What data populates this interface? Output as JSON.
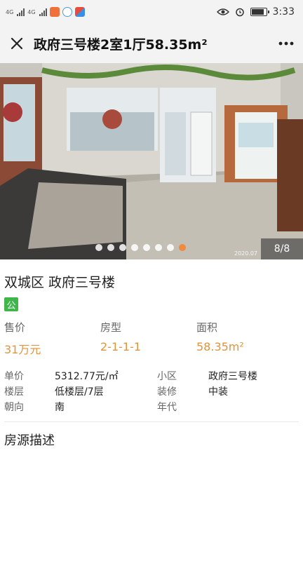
{
  "status_bar": {
    "network_1": "4G",
    "network_2": "4G",
    "time": "3:33"
  },
  "nav": {
    "title": "政府三号楼2室1厅58.35m²"
  },
  "gallery": {
    "counter": "8/8",
    "dot_count": 8,
    "active_index": 7,
    "photo_stamp": "2020.07"
  },
  "listing": {
    "location": "双城区 政府三号楼",
    "tag": "公",
    "stats": [
      {
        "label": "售价",
        "value": "31万元"
      },
      {
        "label": "房型",
        "value": "2-1-1-1"
      },
      {
        "label": "面积",
        "value": "58.35m²"
      }
    ],
    "details": [
      {
        "label": "单价",
        "value": "5312.77元/㎡"
      },
      {
        "label": "小区",
        "value": "政府三号楼"
      },
      {
        "label": "楼层",
        "value": "低楼层/7层"
      },
      {
        "label": "装修",
        "value": "中装"
      },
      {
        "label": "朝向",
        "value": "南"
      },
      {
        "label": "年代",
        "value": ""
      }
    ],
    "section_title": "房源描述"
  },
  "colors": {
    "accent": "#e0943c",
    "tag_green": "#3fb54a",
    "dot_active": "#f08a3c"
  }
}
